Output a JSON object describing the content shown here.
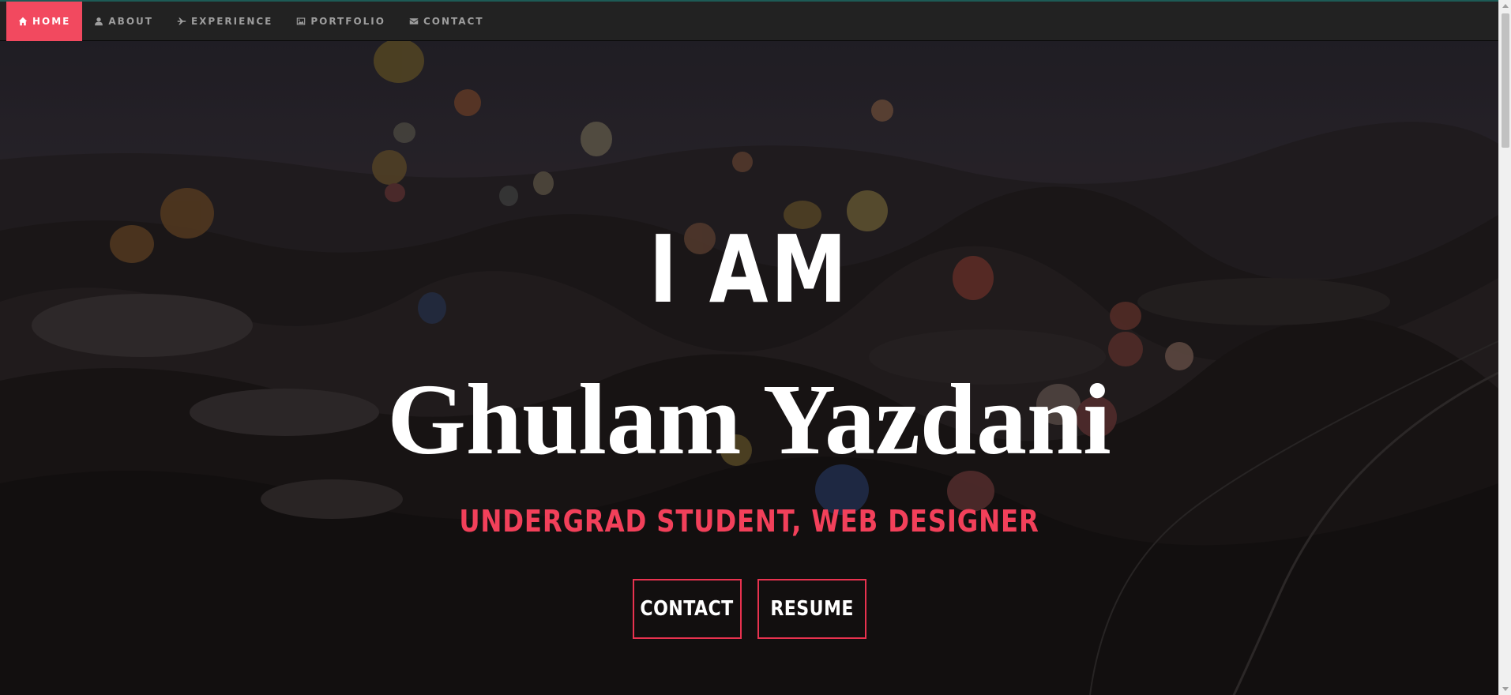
{
  "nav": {
    "items": [
      {
        "label": "HOME",
        "icon": "home-icon",
        "active": true
      },
      {
        "label": "ABOUT",
        "icon": "user-icon",
        "active": false
      },
      {
        "label": "EXPERIENCE",
        "icon": "plane-icon",
        "active": false
      },
      {
        "label": "PORTFOLIO",
        "icon": "image-icon",
        "active": false
      },
      {
        "label": "CONTACT",
        "icon": "envelope-icon",
        "active": false
      }
    ]
  },
  "hero": {
    "intro": "I AM",
    "name": "Ghulam Yazdani",
    "tagline": "UNDERGRAD STUDENT, WEB DESIGNER",
    "buttons": {
      "contact": "CONTACT",
      "resume": "RESUME"
    }
  },
  "colors": {
    "accent": "#f2495f",
    "navbar": "#222222"
  }
}
